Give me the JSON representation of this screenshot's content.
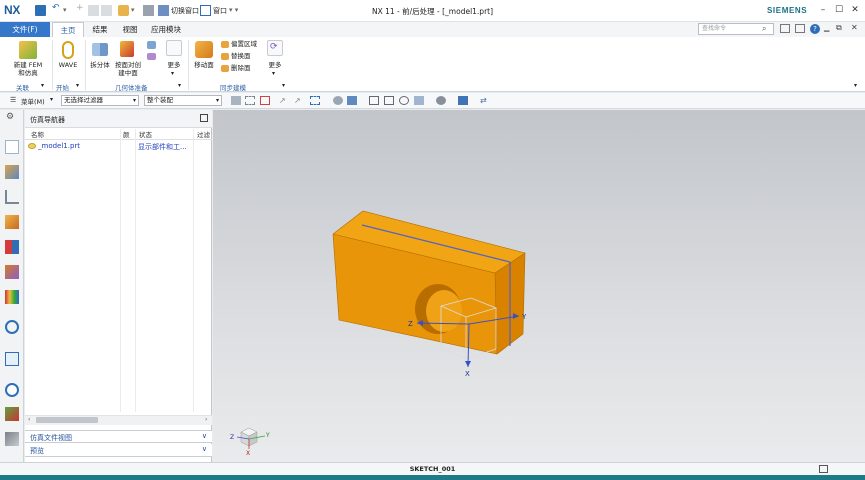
{
  "titlebar": {
    "logo": "NX",
    "switch_window": "切换窗口",
    "window_menu": "窗口",
    "title": "NX 11 - 前/后处理 - [_model1.prt]",
    "brand": "SIEMENS"
  },
  "tabs": [
    "文件(F)",
    "主页",
    "结果",
    "视图",
    "应用模块"
  ],
  "search": {
    "placeholder": "查找命令"
  },
  "ribbon": {
    "new_fem": "新建 FEM",
    "new_fem2": "和仿真",
    "wave": "WAVE",
    "split_body": "拆分体",
    "split_by_face": "按面对创",
    "split_by_face2": "建中面",
    "more1": "更多",
    "move_face": "移动面",
    "offset_region": "偏置区域",
    "replace_face": "替换面",
    "delete_face": "删除面",
    "more2": "更多",
    "groups": [
      "关联",
      "开始",
      "几何体准备",
      "同步建模"
    ]
  },
  "toolbar": {
    "menu": "菜单(M)",
    "filter": "无选择过滤器",
    "assembly": "整个装配"
  },
  "navigator": {
    "title": "仿真导航器",
    "columns": [
      "名称",
      "颜",
      "状态",
      "过滤"
    ],
    "rows": [
      {
        "name": "_model1.prt",
        "status": "显示部件和工..."
      }
    ],
    "sections": [
      "仿真文件视图",
      "预览"
    ]
  },
  "viewport": {
    "axis_z": "Z",
    "axis_y": "Y",
    "axis_x": "X"
  },
  "status": {
    "sketch": "SKETCH_001"
  },
  "colors": {
    "accent": "#3577c9",
    "part_face_top": "#f2a514",
    "part_face_front": "#e08c06",
    "part_face_side": "#d97d00",
    "teal": "#1f7a88"
  }
}
